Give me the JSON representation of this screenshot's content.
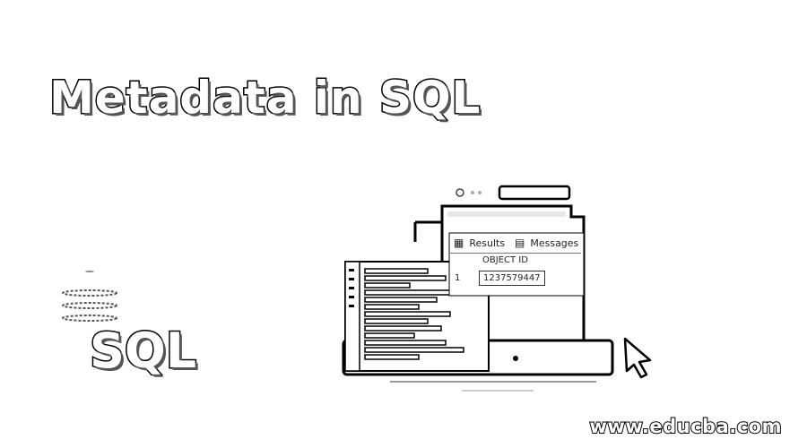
{
  "title": "Metadata in SQL",
  "sql_label": "SQL",
  "footer": {
    "site": "www.educba.com"
  },
  "results_window": {
    "tabs": [
      {
        "label": "Results",
        "icon": "grid-icon"
      },
      {
        "label": "Messages",
        "icon": "messages-icon"
      }
    ],
    "column_header": "OBJECT ID",
    "rows": [
      {
        "row_number": "1",
        "object_id": "1237579447"
      }
    ]
  },
  "icons": [
    "database-stack-icon",
    "monitor-icon",
    "cursor-icon",
    "window-dots-icon"
  ]
}
